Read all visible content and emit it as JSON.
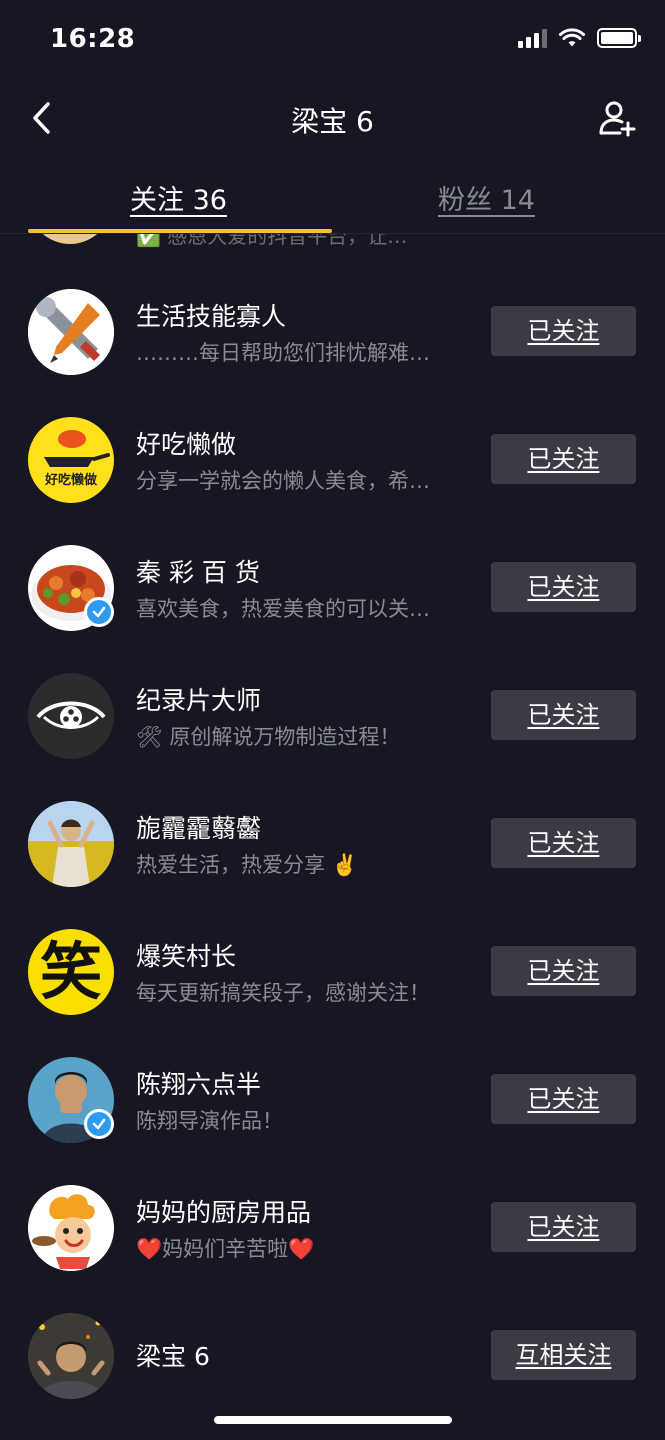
{
  "status": {
    "time": "16:28"
  },
  "nav": {
    "title": "梁宝 6"
  },
  "tabs": {
    "following": "关注 36",
    "fans": "粉丝 14"
  },
  "partial_item": {
    "bio": "✅ 感恩大爱的抖音平台，让…"
  },
  "following_list": [
    {
      "name": "生活技能寡人",
      "bio": "………每日帮助您们排忧解难…",
      "button": "已关注"
    },
    {
      "name": "好吃懒做",
      "bio": "分享一学就会的懒人美食，希…",
      "button": "已关注",
      "avatar_text": "好吃懒做"
    },
    {
      "name": "秦 彩 百 货",
      "bio": "喜欢美食，热爱美食的可以关…",
      "button": "已关注"
    },
    {
      "name": "纪录片大师",
      "bio": "🛠 原创解说万物制造过程！",
      "button": "已关注"
    },
    {
      "name": "旎龗靇蘙齾",
      "bio": "热爱生活，热爱分享 ✌️",
      "button": "已关注"
    },
    {
      "name": "爆笑村长",
      "bio": "每天更新搞笑段子，感谢关注！",
      "button": "已关注",
      "avatar_text": "笑"
    },
    {
      "name": "陈翔六点半",
      "bio": "陈翔导演作品！",
      "button": "已关注"
    },
    {
      "name": "妈妈的厨房用品",
      "bio": "❤️妈妈们辛苦啦❤️",
      "button": "已关注"
    },
    {
      "name": "梁宝 6",
      "bio": "",
      "button": "互相关注"
    }
  ],
  "colors": {
    "background": "#161722",
    "button": "#3a3b45",
    "accent": "#f5c232",
    "verified": "#2d9cf0"
  }
}
